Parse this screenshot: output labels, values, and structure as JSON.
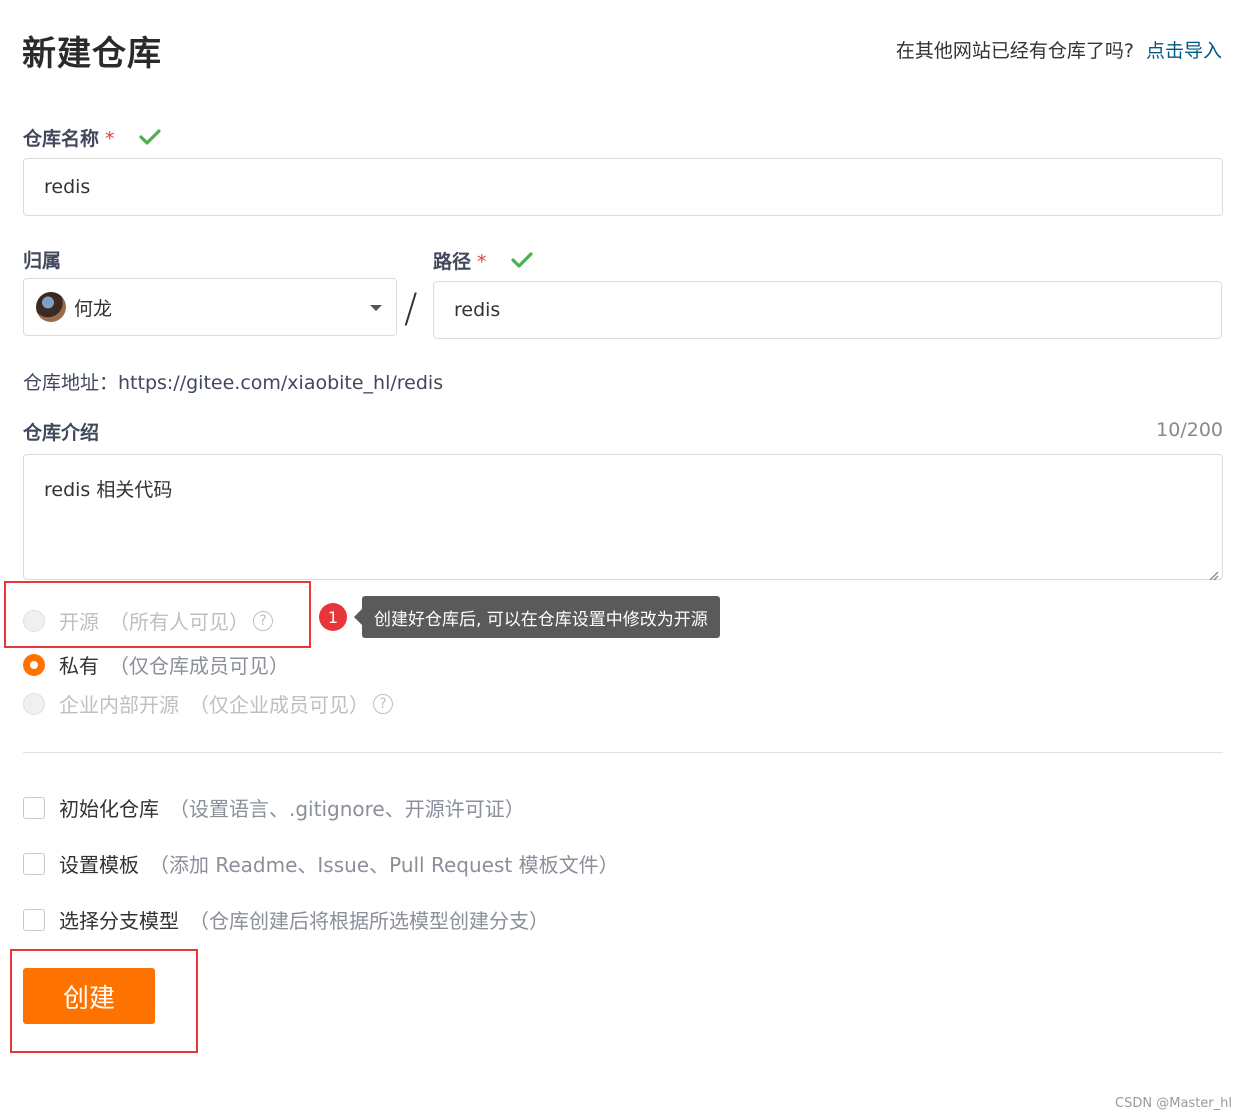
{
  "header": {
    "title": "新建仓库",
    "import_question": "在其他网站已经有仓库了吗?",
    "import_link": "点击导入"
  },
  "repo_name": {
    "label": "仓库名称",
    "required_mark": "*",
    "value": "redis"
  },
  "owner": {
    "label": "归属",
    "value": "何龙"
  },
  "separator": "/",
  "path": {
    "label": "路径",
    "required_mark": "*",
    "value": "redis"
  },
  "repo_address": "仓库地址：https://gitee.com/xiaobite_hl/redis",
  "description": {
    "label": "仓库介绍",
    "counter": "10/200",
    "value": "redis 相关代码"
  },
  "visibility": {
    "options": [
      {
        "label": "开源",
        "note": "（所有人可见）",
        "selected": false,
        "disabled": true,
        "help": "?"
      },
      {
        "label": "私有",
        "note": "（仅仓库成员可见）",
        "selected": true,
        "disabled": false
      },
      {
        "label": "企业内部开源",
        "note": "（仅企业成员可见）",
        "selected": false,
        "disabled": true,
        "help": "?"
      }
    ],
    "tooltip_badge": "1",
    "tooltip_text": "创建好仓库后, 可以在仓库设置中修改为开源"
  },
  "options": [
    {
      "label": "初始化仓库",
      "note": "（设置语言、.gitignore、开源许可证）",
      "checked": false
    },
    {
      "label": "设置模板",
      "note": "（添加 Readme、Issue、Pull Request 模板文件）",
      "checked": false
    },
    {
      "label": "选择分支模型",
      "note": "（仓库创建后将根据所选模型创建分支）",
      "checked": false
    }
  ],
  "create_button": "创建",
  "watermark": "CSDN @Master_hl",
  "colors": {
    "accent": "#fe7300",
    "link": "#005980",
    "check": "#4caf50",
    "highlight": "#e8353a"
  }
}
